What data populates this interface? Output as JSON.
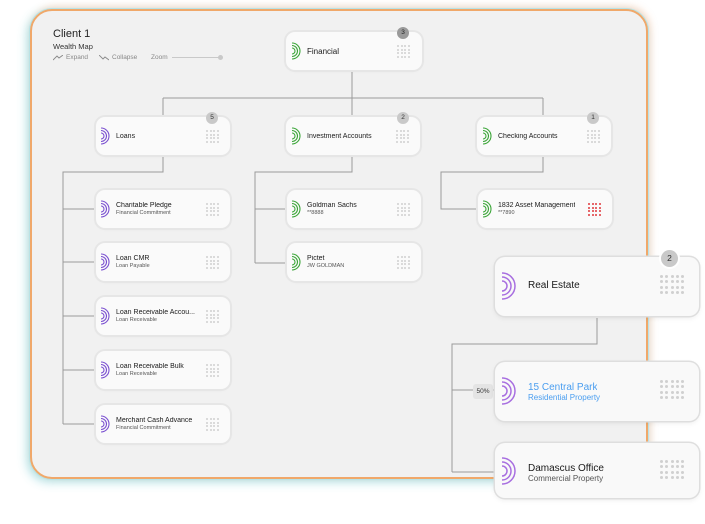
{
  "header": {
    "title": "Client 1",
    "subtitle": "Wealth Map"
  },
  "controls": {
    "expand_label": "Expand",
    "collapse_label": "Collapse",
    "zoom_label": "Zoom"
  },
  "colors": {
    "green": "#3aa537",
    "purple": "#7a4fd0",
    "dots": "#d0d0d0",
    "red_dots": "#e0383b",
    "link_blue": "#4a9ef0",
    "badge_gray": "#c9c9c9"
  },
  "nodes": {
    "financial": {
      "name": "Financial",
      "count": "3",
      "icon": "arc-green-icon"
    },
    "loans": {
      "name": "Loans",
      "count": "5",
      "icon": "arc-purple-icon"
    },
    "investment": {
      "name": "Investment Accounts",
      "count": "2",
      "icon": "arc-green-icon"
    },
    "checking": {
      "name": "Checking Accounts",
      "count": "1",
      "icon": "arc-green-icon"
    },
    "charitable": {
      "name": "Charitable Pledge",
      "sub": "Financial Commitment"
    },
    "loan_cmr": {
      "name": "Loan CMR",
      "sub": "Loan Payable"
    },
    "loan_recv_accou": {
      "name": "Loan Receivable Accou...",
      "sub": "Loan Receivable"
    },
    "loan_recv_bulk": {
      "name": "Loan Receivable Bulk",
      "sub": "Loan Receivable"
    },
    "merchant": {
      "name": "Merchant Cash Advance",
      "sub": "Financial Commitment"
    },
    "goldman": {
      "name": "Goldman Sachs",
      "sub": "**8888"
    },
    "pictet": {
      "name": "Pictet",
      "sub": "JW GOLDMAN"
    },
    "asset1832": {
      "name": "1832 Asset Management",
      "sub": "**7890"
    },
    "real_estate": {
      "name": "Real Estate",
      "count": "2"
    },
    "central_park": {
      "name": "15 Central Park",
      "sub": "Residential Property",
      "percent": "50%"
    },
    "damascus": {
      "name": "Damascus Office",
      "sub": "Commercial Property"
    }
  }
}
